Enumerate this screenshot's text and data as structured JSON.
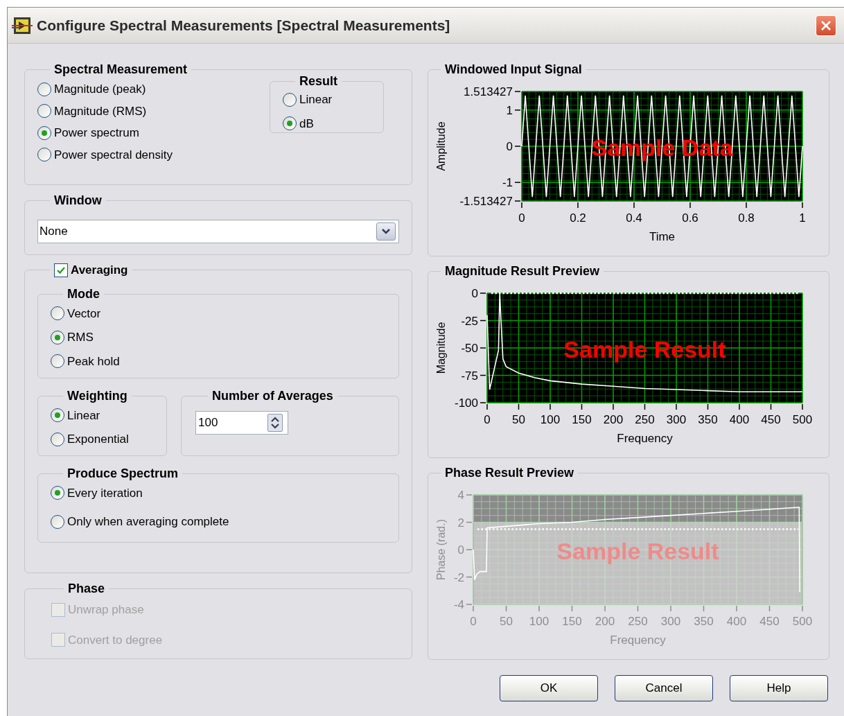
{
  "window": {
    "title": "Configure Spectral Measurements [Spectral Measurements]"
  },
  "spectral_measurement": {
    "title": "Spectral Measurement",
    "options": [
      {
        "label": "Magnitude (peak)",
        "selected": false
      },
      {
        "label": "Magnitude (RMS)",
        "selected": false
      },
      {
        "label": "Power spectrum",
        "selected": true
      },
      {
        "label": "Power spectral density",
        "selected": false
      }
    ]
  },
  "result": {
    "title": "Result",
    "options": [
      {
        "label": "Linear",
        "selected": false
      },
      {
        "label": "dB",
        "selected": true
      }
    ]
  },
  "window_group": {
    "title": "Window",
    "value": "None"
  },
  "averaging": {
    "label": "Averaging",
    "checked": true,
    "mode": {
      "title": "Mode",
      "options": [
        {
          "label": "Vector",
          "selected": false
        },
        {
          "label": "RMS",
          "selected": true
        },
        {
          "label": "Peak hold",
          "selected": false
        }
      ]
    },
    "weighting": {
      "title": "Weighting",
      "options": [
        {
          "label": "Linear",
          "selected": true
        },
        {
          "label": "Exponential",
          "selected": false
        }
      ]
    },
    "number_of_averages": {
      "title": "Number of Averages",
      "value": "100"
    },
    "produce_spectrum": {
      "title": "Produce Spectrum",
      "options": [
        {
          "label": "Every iteration",
          "selected": true
        },
        {
          "label": "Only when averaging complete",
          "selected": false
        }
      ]
    }
  },
  "phase": {
    "title": "Phase",
    "options": [
      {
        "label": "Unwrap phase",
        "checked": false,
        "disabled": true
      },
      {
        "label": "Convert to degree",
        "checked": false,
        "disabled": true
      }
    ]
  },
  "graphs": [
    {
      "overlay": "Sample Data",
      "disabled": false,
      "chart_data": {
        "type": "line",
        "title": "Windowed Input Signal",
        "xlabel": "Time",
        "ylabel": "Amplitude",
        "xlim": [
          0,
          1
        ],
        "ylim": [
          -1.513427,
          1.513427
        ],
        "xticks": [
          0,
          0.2,
          0.4,
          0.6,
          0.8,
          1
        ],
        "yticks": [
          {
            "value": 1.513427,
            "label": "1.513427"
          },
          1,
          0,
          -1,
          {
            "value": -1.513427,
            "label": "-1.513427"
          }
        ],
        "x": [
          0,
          0.0125,
          0.025,
          0.0375,
          0.05,
          0.0625,
          0.075,
          0.0875,
          0.1,
          0.1125,
          0.125,
          0.1375,
          0.15,
          0.1625,
          0.175,
          0.1875,
          0.2,
          0.2125,
          0.225,
          0.2375,
          0.25,
          0.2625,
          0.275,
          0.2875,
          0.3,
          0.3125,
          0.325,
          0.3375,
          0.35,
          0.3625,
          0.375,
          0.3875,
          0.4,
          0.4125,
          0.425,
          0.4375,
          0.45,
          0.4625,
          0.475,
          0.4875,
          0.5,
          0.5125,
          0.525,
          0.5375,
          0.55,
          0.5625,
          0.575,
          0.5875,
          0.6,
          0.6125,
          0.625,
          0.6375,
          0.65,
          0.6625,
          0.675,
          0.6875,
          0.7,
          0.7125,
          0.725,
          0.7375,
          0.75,
          0.7625,
          0.775,
          0.7875,
          0.8,
          0.8125,
          0.825,
          0.8375,
          0.85,
          0.8625,
          0.875,
          0.8875,
          0.9,
          0.9125,
          0.925,
          0.9375,
          0.95,
          0.9625,
          0.975,
          0.9875,
          1
        ],
        "grid": true,
        "series": [
          {
            "color": "#ffffff",
            "values": [
              0,
              1.4,
              0,
              -1.4,
              0,
              1.4,
              0,
              -1.4,
              0,
              1.4,
              0,
              -1.4,
              0,
              1.4,
              0,
              -1.4,
              0,
              1.4,
              0,
              -1.4,
              0,
              1.4,
              0,
              -1.4,
              0,
              1.4,
              0,
              -1.4,
              0,
              1.4,
              0,
              -1.4,
              0,
              1.4,
              0,
              -1.4,
              0,
              1.4,
              0,
              -1.4,
              0,
              1.4,
              0,
              -1.4,
              0,
              1.4,
              0,
              -1.4,
              0,
              1.4,
              0,
              -1.4,
              0,
              1.4,
              0,
              -1.4,
              0,
              1.4,
              0,
              -1.4,
              0,
              1.4,
              0,
              -1.4,
              0,
              1.4,
              0,
              -1.4,
              0,
              1.4,
              0,
              -1.4,
              0,
              1.4,
              0,
              -1.4,
              0,
              1.4,
              0,
              -1.4,
              0
            ]
          }
        ]
      }
    },
    {
      "overlay": "Sample Result",
      "disabled": false,
      "chart_data": {
        "type": "line",
        "title": "Magnitude Result Preview",
        "xlabel": "Frequency",
        "ylabel": "Magnitude",
        "xlim": [
          0,
          500
        ],
        "ylim": [
          -100,
          0
        ],
        "xticks": [
          0,
          50,
          100,
          150,
          200,
          250,
          300,
          350,
          400,
          450,
          500
        ],
        "yticks": [
          0,
          -25,
          -50,
          -75,
          -100
        ],
        "x": [
          0,
          2,
          4,
          18,
          20,
          22,
          25,
          30,
          50,
          75,
          100,
          150,
          200,
          250,
          300,
          350,
          400,
          450,
          500
        ],
        "grid": true,
        "series": [
          {
            "color": "#ffffff",
            "values": [
              -20,
              -55,
              -88,
              -52,
              0,
              -25,
              -60,
              -67,
              -73,
              -77,
              -80,
              -83,
              -85,
              -87,
              -88,
              -89,
              -90,
              -90,
              -90
            ]
          }
        ],
        "ref_lines": [
          {
            "axis": "y",
            "value": 0,
            "color": "#ffffff"
          }
        ]
      }
    },
    {
      "overlay": "Sample Result",
      "disabled": true,
      "chart_data": {
        "type": "line",
        "title": "Phase Result Preview",
        "xlabel": "Frequency",
        "ylabel": "Phase (rad.)",
        "xlim": [
          0,
          500
        ],
        "ylim": [
          -4,
          4
        ],
        "xticks": [
          0,
          50,
          100,
          150,
          200,
          250,
          300,
          350,
          400,
          450,
          500
        ],
        "yticks": [
          4,
          2,
          0,
          -2,
          -4
        ],
        "x": [
          0,
          1,
          2,
          5,
          10,
          20,
          21,
          50,
          100,
          150,
          200,
          250,
          300,
          350,
          400,
          450,
          495,
          496
        ],
        "grid": true,
        "series": [
          {
            "color": "#ffffff",
            "values": [
              0,
              -1.2,
              -2.2,
              -1.8,
              -1.6,
              -1.6,
              1.6,
              1.7,
              1.9,
              2.0,
              2.2,
              2.35,
              2.5,
              2.65,
              2.8,
              2.95,
              3.1,
              -3.1
            ]
          }
        ],
        "ref_lines": [
          {
            "axis": "y",
            "value": 1.5,
            "color": "#ffffff"
          }
        ],
        "bands": [
          {
            "axis": "y",
            "from": -4,
            "to": 2,
            "color": "#d4d4d4"
          }
        ]
      }
    }
  ],
  "buttons": [
    {
      "label": "OK"
    },
    {
      "label": "Cancel"
    },
    {
      "label": "Help"
    }
  ]
}
